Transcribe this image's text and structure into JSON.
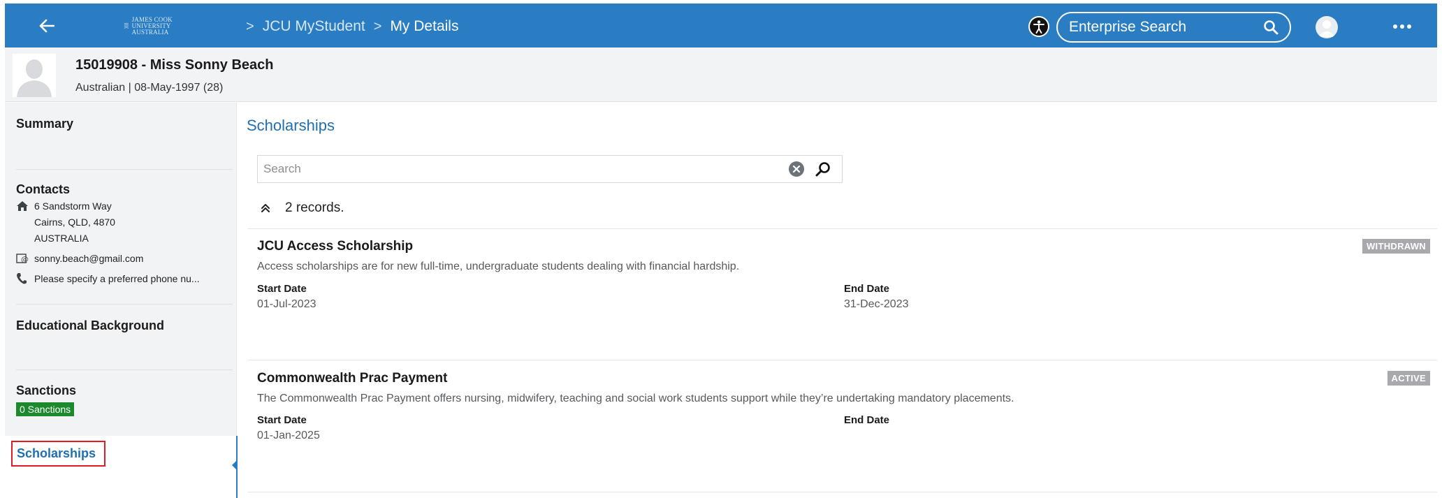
{
  "topbar": {
    "logo_text": "JAMES COOK UNIVERSITY AUSTRALIA",
    "breadcrumb": [
      "JCU MyStudent",
      "My Details"
    ],
    "search_placeholder": "Enterprise Search",
    "brand_color": "#2a7dc2"
  },
  "profile": {
    "name": "15019908 - Miss Sonny Beach",
    "details": "Australian | 08-May-1997 (28)"
  },
  "sidebar": {
    "summary": "Summary",
    "contacts": {
      "title": "Contacts",
      "address": [
        "6 Sandstorm Way",
        "Cairns, QLD, 4870",
        "AUSTRALIA"
      ],
      "email": "sonny.beach@gmail.com",
      "phone": "Please specify a preferred phone nu..."
    },
    "educational_background": "Educational Background",
    "sanctions": {
      "title": "Sanctions",
      "badge": "0 Sanctions"
    },
    "scholarships": "Scholarships"
  },
  "main": {
    "title": "Scholarships",
    "search_placeholder": "Search",
    "records_text": "2 records.",
    "scholarships": [
      {
        "title": "JCU Access Scholarship",
        "description": "Access scholarships are for new full-time, undergraduate students dealing with financial hardship.",
        "status": "WITHDRAWN",
        "start_label": "Start Date",
        "start_date": "01-Jul-2023",
        "end_label": "End Date",
        "end_date": "31-Dec-2023"
      },
      {
        "title": "Commonwealth Prac Payment",
        "description": "The Commonwealth Prac Payment offers nursing, midwifery, teaching and social work students support while they’re undertaking mandatory placements.",
        "status": "ACTIVE",
        "start_label": "Start Date",
        "start_date": "01-Jan-2025",
        "end_label": "End Date",
        "end_date": ""
      }
    ]
  },
  "colors": {
    "active_badge_green": "#1c8a2c",
    "highlight_red": "#e01b24",
    "link_blue": "#1f6fb2",
    "status_grey": "#a7a9ac"
  },
  "icons": [
    "back-arrow-icon",
    "university-logo",
    "accessibility-icon",
    "search-icon",
    "user-avatar-icon",
    "more-icon",
    "home-icon",
    "email-icon",
    "phone-icon",
    "clear-icon",
    "chevron-up-double-icon"
  ]
}
